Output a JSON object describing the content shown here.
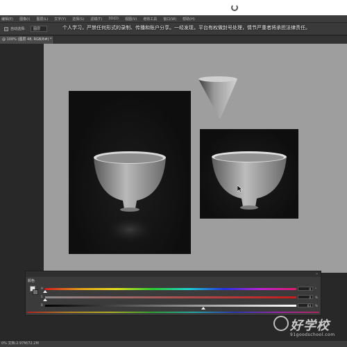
{
  "menu": {
    "items": [
      "编辑(E)",
      "图像(I)",
      "图层(L)",
      "文字(Y)",
      "选择(S)",
      "滤镜(T)",
      "3D(D)",
      "视图(V)",
      "增效工具",
      "窗口(W)",
      "帮助(H)"
    ]
  },
  "notice": "个人学习，严禁任何形式的录制、传播和账户分享。一经发现，平台有权做封号处理，情节严重者将承担法律责任。",
  "options_bar": {
    "auto_select_label": "自动选择:",
    "layer_select": "图层"
  },
  "document_tab": {
    "label": "@ 100% (图层 48, RGB/8#) *"
  },
  "color_panel": {
    "title": "颜色",
    "collapse_glyph": "»",
    "sliders": [
      {
        "label": "H",
        "value": "0",
        "unit": "°",
        "thumb_fraction": 0.0
      },
      {
        "label": "S",
        "value": "0",
        "unit": "%",
        "thumb_fraction": 0.0
      },
      {
        "label": "B",
        "value": "63",
        "unit": "%",
        "thumb_fraction": 0.63
      }
    ]
  },
  "status_bar": {
    "text": "0% 文档:2.97M/72.2M"
  },
  "watermark": {
    "brand": "好学校",
    "url": "91goodschool.com"
  },
  "colors": {
    "canvas": "#9e9e9e",
    "workspace": "#282828",
    "panel": "#3b3b3b"
  }
}
